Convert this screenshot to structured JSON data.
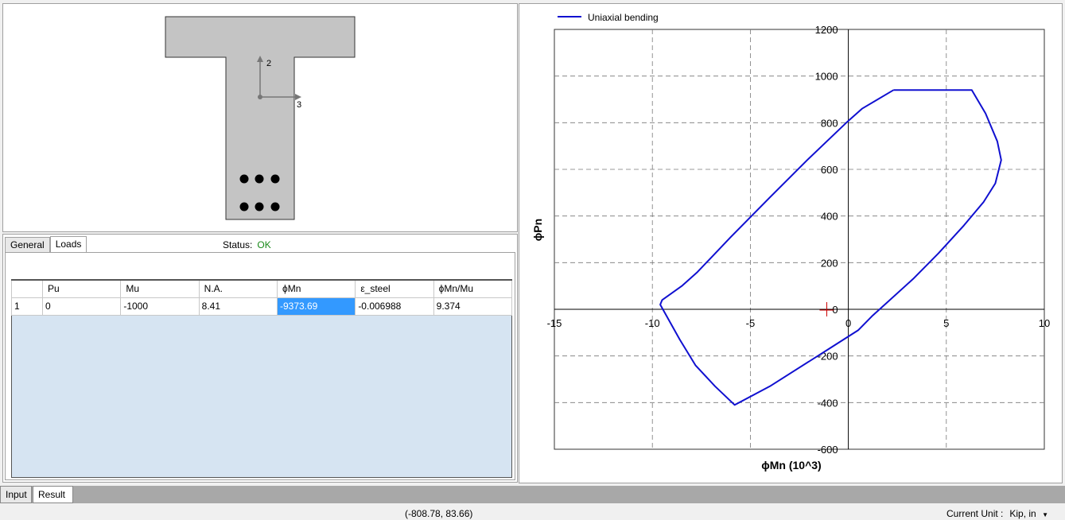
{
  "section": {
    "axis2_label": "2",
    "axis3_label": "3"
  },
  "loads": {
    "tabs": [
      {
        "label": "General",
        "active": false
      },
      {
        "label": "Loads",
        "active": true
      }
    ],
    "status_label": "Status:",
    "status_value": "OK",
    "columns": [
      "Pu",
      "Mu",
      "N.A.",
      "ϕMn",
      "ε_steel",
      "ϕMn/Mu"
    ],
    "rows": [
      {
        "index": "1",
        "cells": [
          "0",
          "-1000",
          "8.41",
          "-9373.69",
          "-0.006988",
          "9.374"
        ]
      }
    ]
  },
  "chart_data": {
    "type": "line",
    "series": [
      {
        "name": "Uniaxial bending",
        "color": "#1010d0",
        "points": [
          [
            2.3,
            940
          ],
          [
            6.3,
            940
          ],
          [
            7.0,
            840
          ],
          [
            7.6,
            720
          ],
          [
            7.8,
            640
          ],
          [
            7.5,
            540
          ],
          [
            6.9,
            460
          ],
          [
            5.9,
            360
          ],
          [
            4.6,
            240
          ],
          [
            3.3,
            130
          ],
          [
            1.2,
            -30
          ],
          [
            0.5,
            -90
          ],
          [
            -1.0,
            -170
          ],
          [
            -4.0,
            -330
          ],
          [
            -5.8,
            -410
          ],
          [
            -6.8,
            -330
          ],
          [
            -7.8,
            -240
          ],
          [
            -8.6,
            -130
          ],
          [
            -9.6,
            20
          ],
          [
            -9.5,
            40
          ],
          [
            -8.5,
            100
          ],
          [
            -7.7,
            160
          ],
          [
            -6.0,
            310
          ],
          [
            -4.0,
            480
          ],
          [
            -2.1,
            640
          ],
          [
            -0.1,
            800
          ],
          [
            0.7,
            860
          ],
          [
            2.3,
            940
          ]
        ]
      }
    ],
    "xlim": [
      -15,
      10
    ],
    "ylim": [
      -600,
      1200
    ],
    "xticks": [
      -15,
      -10,
      -5,
      0,
      5,
      10
    ],
    "yticks": [
      -600,
      -400,
      -200,
      0,
      200,
      400,
      600,
      800,
      1000,
      1200
    ],
    "xlabel": "ϕMn (10^3)",
    "ylabel": "ϕPn",
    "grid": true,
    "legend": "top-left"
  },
  "bottom_tabs": [
    {
      "label": "Input",
      "active": false
    },
    {
      "label": "Result",
      "active": true
    }
  ],
  "statusbar": {
    "coords": "(-808.78, 83.66)",
    "unit_label": "Current Unit :",
    "unit_value": "Kip, in"
  }
}
